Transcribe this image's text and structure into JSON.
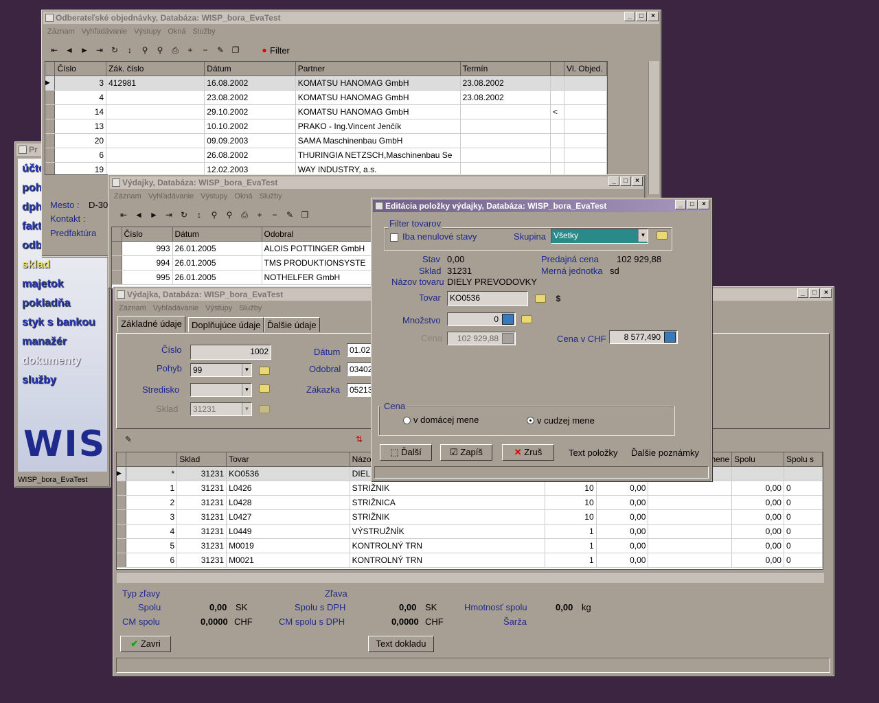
{
  "menu": [
    "Záznam",
    "Vyhľadávanie",
    "Výstupy",
    "Okná",
    "Služby"
  ],
  "win_orders": {
    "title": "Odberateľské objednávky,  Databáza: WISP_bora_EvaTest",
    "filter_label": "Filter",
    "columns": [
      "Číslo",
      "Zák. číslo",
      "Dátum",
      "Partner",
      "Termín",
      "",
      "Vl. Objed."
    ],
    "rows": [
      [
        "3",
        "412981",
        "16.08.2002",
        "KOMATSU HANOMAG GmbH",
        "23.08.2002",
        "",
        ""
      ],
      [
        "4",
        "",
        "23.08.2002",
        "KOMATSU HANOMAG GmbH",
        "23.08.2002",
        "",
        ""
      ],
      [
        "14",
        "",
        "29.10.2002",
        "KOMATSU HANOMAG GmbH",
        "",
        "<",
        ""
      ],
      [
        "13",
        "",
        "10.10.2002",
        "PRAKO - Ing.Vincent Jenčík",
        "",
        "",
        ""
      ],
      [
        "20",
        "",
        "09.09.2003",
        "SAMA Maschinenbau GmbH",
        "",
        "",
        ""
      ],
      [
        "6",
        "",
        "26.08.2002",
        "THURINGIA NETZSCH,Maschinenbau Se",
        "",
        "",
        ""
      ],
      [
        "19",
        "",
        "12.02.2003",
        "WAY INDUSTRY, a.s.",
        "",
        "",
        ""
      ]
    ],
    "mesto_label": "Mesto :",
    "mesto_value": "D-30",
    "kontakt_label": "Kontakt :",
    "predfaktura_label": "Predfaktúra"
  },
  "win_main": {
    "title": "Pr",
    "items": [
      "účto",
      "poh",
      "dph",
      "fakt",
      "odb",
      "sklad",
      "majetok",
      "pokladňa",
      "styk s bankou",
      "manažér",
      "dokumenty",
      "služby"
    ],
    "logo": "WIS",
    "status": "WISP_bora_EvaTest"
  },
  "win_vydajky": {
    "title": "Výdajky,  Databáza: WISP_bora_EvaTest",
    "columns": [
      "Číslo",
      "Dátum",
      "Odobral"
    ],
    "rows": [
      [
        "993",
        "26.01.2005",
        "ALOIS POTTINGER GmbH"
      ],
      [
        "994",
        "26.01.2005",
        "TMS PRODUKTIONSYSTE"
      ],
      [
        "995",
        "26.01.2005",
        "NOTHELFER GmbH"
      ]
    ]
  },
  "win_vydajka": {
    "title": "Výdajka,  Databáza: WISP_bora_EvaTest",
    "tabs": [
      "Základné údaje",
      "Doplňujúce údaje",
      "Ďalšie údaje"
    ],
    "cislo_label": "Číslo",
    "cislo_value": "1002",
    "pohyb_label": "Pohyb",
    "pohyb_value": "99",
    "stredisko_label": "Stredisko",
    "stredisko_value": "",
    "sklad_label": "Sklad",
    "sklad_value": "31231",
    "datum_label": "Dátum",
    "datum_value": "01.02",
    "odobral_label": "Odobral",
    "odobral_value": "03402",
    "zakazka_label": "Zákazka",
    "zakazka_value": "05213",
    "columns": [
      "",
      "Sklad",
      "Tovar",
      "Názov",
      "",
      "",
      "",
      "Spolu",
      "Spolu s"
    ],
    "col_mene": "mene",
    "rows": [
      [
        "*",
        "31231",
        "KO0536",
        "DIEL",
        "",
        "",
        "",
        "",
        ""
      ],
      [
        "1",
        "31231",
        "L0426",
        "STRIŽNIK",
        "10",
        "0,00",
        "",
        "0,00",
        "0"
      ],
      [
        "2",
        "31231",
        "L0428",
        "STRIŽNICA",
        "10",
        "0,00",
        "",
        "0,00",
        "0"
      ],
      [
        "3",
        "31231",
        "L0427",
        "STRIŽNIK",
        "10",
        "0,00",
        "",
        "0,00",
        "0"
      ],
      [
        "4",
        "31231",
        "L0449",
        "VÝSTRUŽNÍK",
        "1",
        "0,00",
        "",
        "0,00",
        "0"
      ],
      [
        "5",
        "31231",
        "M0019",
        "KONTROLNÝ TRN",
        "1",
        "0,00",
        "",
        "0,00",
        "0"
      ],
      [
        "6",
        "31231",
        "M0021",
        "KONTROLNÝ TRN",
        "1",
        "0,00",
        "",
        "0,00",
        "0"
      ]
    ],
    "typ_zlavy_label": "Typ zľavy",
    "zlava_label": "Zľava",
    "spolu_label": "Spolu",
    "spolu_value": "0,00",
    "spolu_cur": "SK",
    "spolu_dph_label": "Spolu s DPH",
    "spolu_dph_value": "0,00",
    "spolu_dph_cur": "SK",
    "hmotnost_label": "Hmotnosť spolu",
    "hmotnost_value": "0,00",
    "hmotnost_unit": "kg",
    "cm_spolu_label": "CM spolu",
    "cm_spolu_value": "0,0000",
    "cm_spolu_cur": "CHF",
    "cm_dph_label": "CM spolu s DPH",
    "cm_dph_value": "0,0000",
    "cm_dph_cur": "CHF",
    "sarza_label": "Šarža",
    "zavri_label": "Zavri",
    "text_dokladu_label": "Text dokladu"
  },
  "win_edit": {
    "title": "Editácia položky výdajky,  Databáza: WISP_bora_EvaTest",
    "filter_group": "Filter tovarov",
    "nenulove_label": "Iba nenulové stavy",
    "skupina_label": "Skupina",
    "skupina_value": "Všetky",
    "stav_label": "Stav",
    "stav_value": "0,00",
    "sklad_label": "Sklad",
    "sklad_value": "31231",
    "nazov_label": "Názov tovaru",
    "nazov_value": "DIELY PREVODOVKY",
    "predajna_label": "Predajná cena",
    "predajna_value": "102 929,88",
    "jednotka_label": "Merná jednotka",
    "jednotka_value": "sd",
    "tovar_label": "Tovar",
    "tovar_value": "KO0536",
    "mnozstvo_label": "Množstvo",
    "mnozstvo_value": "0",
    "cena_label": "Cena",
    "cena_value": "102 929,88",
    "cena_chf_label": "Cena v CHF",
    "cena_chf_value": "8 577,490",
    "cena_group": "Cena",
    "radio_domaca": "v domácej mene",
    "radio_cudza": "v cudzej mene",
    "btn_dalsi": "Ďalší",
    "btn_zapis": "Zapíš",
    "btn_zrus": "Zruš",
    "btn_text": "Text položky",
    "btn_poznamky": "Ďalšie poznámky"
  }
}
